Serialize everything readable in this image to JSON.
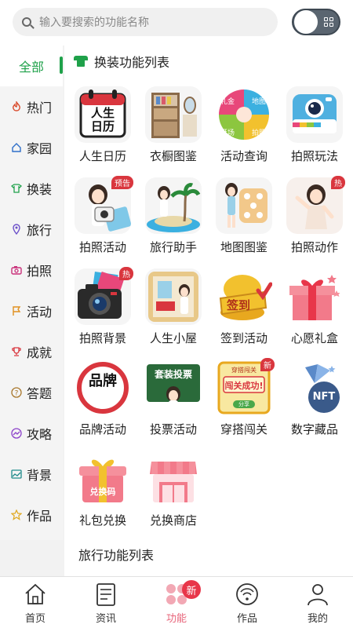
{
  "search": {
    "placeholder": "输入要搜索的功能名称"
  },
  "sidebar": {
    "items": [
      {
        "label": "全部",
        "icon": "none"
      },
      {
        "label": "热门",
        "icon": "flame-icon"
      },
      {
        "label": "家园",
        "icon": "home-icon"
      },
      {
        "label": "换装",
        "icon": "shirt-icon"
      },
      {
        "label": "旅行",
        "icon": "location-pin-icon"
      },
      {
        "label": "拍照",
        "icon": "camera-icon"
      },
      {
        "label": "活动",
        "icon": "flag-icon"
      },
      {
        "label": "成就",
        "icon": "trophy-icon"
      },
      {
        "label": "答题",
        "icon": "question-icon"
      },
      {
        "label": "攻略",
        "icon": "chat-trend-icon"
      },
      {
        "label": "背景",
        "icon": "image-icon"
      },
      {
        "label": "作品",
        "icon": "star-icon"
      }
    ]
  },
  "section": {
    "title": "换装功能列表"
  },
  "tiles": [
    {
      "label": "人生日历",
      "badge": "",
      "icon": "calendar-icon"
    },
    {
      "label": "衣橱图鉴",
      "badge": "",
      "icon": "wardrobe-icon"
    },
    {
      "label": "活动查询",
      "badge": "",
      "icon": "event-icon"
    },
    {
      "label": "拍照玩法",
      "badge": "",
      "icon": "instant-camera-icon"
    },
    {
      "label": "拍照活动",
      "badge": "预告",
      "icon": "camera-event-icon"
    },
    {
      "label": "旅行助手",
      "badge": "",
      "icon": "island-icon"
    },
    {
      "label": "地图图鉴",
      "badge": "",
      "icon": "dice-map-icon"
    },
    {
      "label": "拍照动作",
      "badge": "热",
      "icon": "pose-icon"
    },
    {
      "label": "拍照背景",
      "badge": "热",
      "icon": "dslr-icon"
    },
    {
      "label": "人生小屋",
      "badge": "",
      "icon": "room-icon"
    },
    {
      "label": "签到活动",
      "badge": "",
      "icon": "checkin-icon"
    },
    {
      "label": "心愿礼盒",
      "badge": "",
      "icon": "gift-box-icon"
    },
    {
      "label": "品牌活动",
      "badge": "",
      "icon": "brand-icon"
    },
    {
      "label": "投票活动",
      "badge": "",
      "icon": "vote-board-icon"
    },
    {
      "label": "穿搭闯关",
      "badge": "新",
      "icon": "challenge-icon"
    },
    {
      "label": "数字藏品",
      "badge": "",
      "icon": "nft-icon"
    },
    {
      "label": "礼包兑换",
      "badge": "",
      "icon": "gift-redeem-icon"
    },
    {
      "label": "兑换商店",
      "badge": "",
      "icon": "shop-icon"
    }
  ],
  "tile_text": {
    "calendar_line1": "人生",
    "calendar_line2": "日历",
    "event_chips": [
      "礼金",
      "地图",
      "逛场",
      "拍照"
    ],
    "checkin": "签到",
    "brand": "品牌",
    "vote": "套装投票",
    "challenge_top": "穿搭闯关",
    "challenge_mid": "闯关成功!",
    "challenge_bottom": "分享",
    "nft": "NFT",
    "redeem": "兑换码"
  },
  "section2": {
    "title": "旅行功能列表"
  },
  "tabbar": {
    "items": [
      {
        "label": "首页",
        "icon": "home-icon"
      },
      {
        "label": "资讯",
        "icon": "news-icon"
      },
      {
        "label": "功能",
        "icon": "function-icon"
      },
      {
        "label": "作品",
        "icon": "works-icon"
      },
      {
        "label": "我的",
        "icon": "person-icon"
      }
    ],
    "badge": "新"
  },
  "colors": {
    "accent": "#1fa14a",
    "tab_active": "#e8647a",
    "badge": "#d9363e"
  }
}
